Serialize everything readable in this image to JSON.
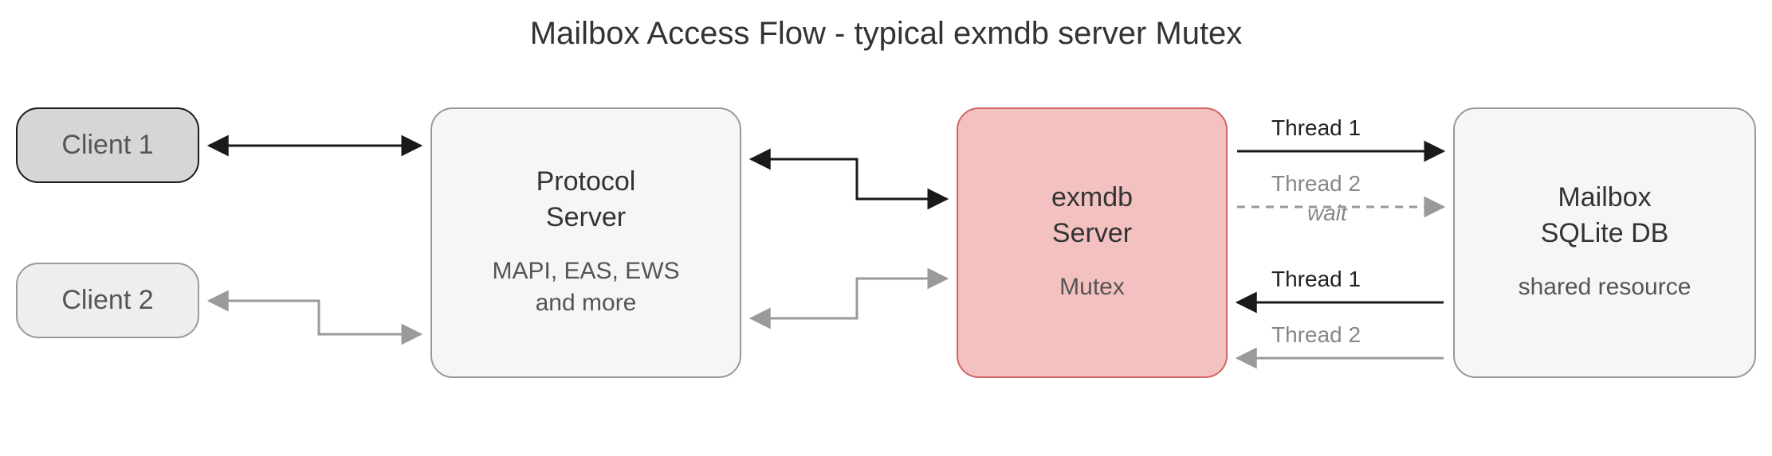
{
  "title": "Mailbox Access Flow - typical exmdb server Mutex",
  "nodes": {
    "client1": {
      "label": "Client 1"
    },
    "client2": {
      "label": "Client 2"
    },
    "protocol": {
      "line1": "Protocol",
      "line2": "Server",
      "sub": "MAPI, EAS, EWS\nand more"
    },
    "exmdb": {
      "line1": "exmdb",
      "line2": "Server",
      "sub": "Mutex"
    },
    "db": {
      "line1": "Mailbox",
      "line2": "SQLite DB",
      "sub": "shared resource"
    }
  },
  "edges": {
    "thread1_out": "Thread 1",
    "thread2_out": "Thread 2",
    "thread2_wait": "wait",
    "thread1_back": "Thread 1",
    "thread2_back": "Thread 2"
  },
  "colors": {
    "dark": "#1a1a1a",
    "gray": "#9a9a9a",
    "exmdb_fill": "#f2c1c0",
    "exmdb_stroke": "#d06666"
  }
}
